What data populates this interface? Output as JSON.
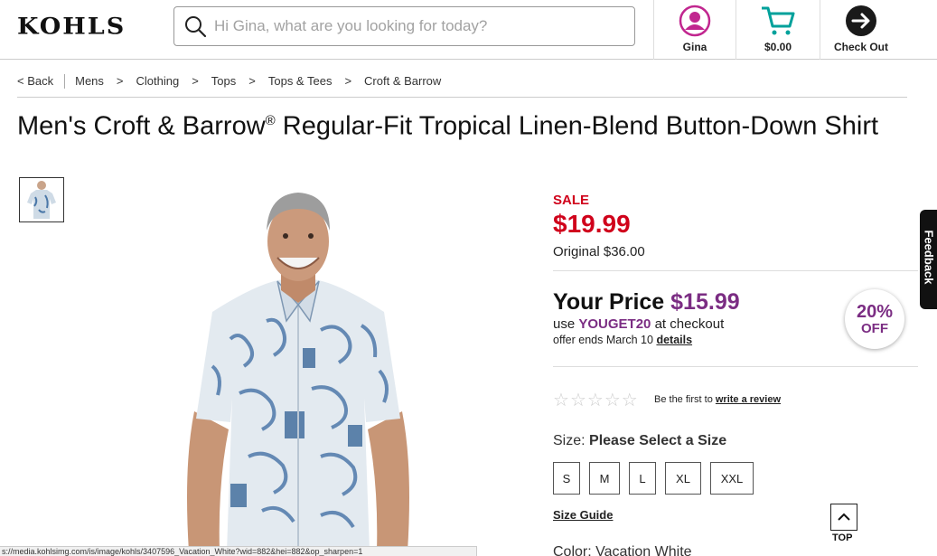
{
  "header": {
    "logo": "KOHLS",
    "search_placeholder": "Hi Gina, what are you looking for today?",
    "account_label": "Gina",
    "cart_label": "$0.00",
    "checkout_label": "Check Out"
  },
  "breadcrumb": {
    "back": "< Back",
    "items": [
      "Mens",
      "Clothing",
      "Tops",
      "Tops & Tees",
      "Croft & Barrow"
    ],
    "separator": ">"
  },
  "product": {
    "title_part1": "Men's Croft & Barrow",
    "title_reg": "®",
    "title_part2": " Regular-Fit Tropical Linen-Blend Button-Down Shirt",
    "sale_label": "SALE",
    "sale_price": "$19.99",
    "original_price": "Original $36.00",
    "your_price_label": "Your Price",
    "your_price": "$15.99",
    "promo_use": "use",
    "promo_code": "YOUGET20",
    "promo_at": "at checkout",
    "offer_ends": "offer ends March 10",
    "details_link": "details",
    "badge_pct": "20%",
    "badge_off": "OFF",
    "rating_text": "Be the first to",
    "review_link": "write a review",
    "size_label": "Size:",
    "size_prompt": "Please Select a Size",
    "sizes": [
      "S",
      "M",
      "L",
      "XL",
      "XXL"
    ],
    "size_guide": "Size Guide",
    "color_label": "Color: Vacation White"
  },
  "floating": {
    "top_label": "TOP",
    "feedback_label": "Feedback"
  },
  "statusbar": "s://media.kohlsimg.com/is/image/kohls/3407596_Vacation_White?wid=882&hei=882&op_sharpen=1",
  "colors": {
    "sale_red": "#d0021b",
    "promo_purple": "#7b2d83",
    "cart_teal": "#00a19b",
    "account_pink": "#c1268f"
  }
}
